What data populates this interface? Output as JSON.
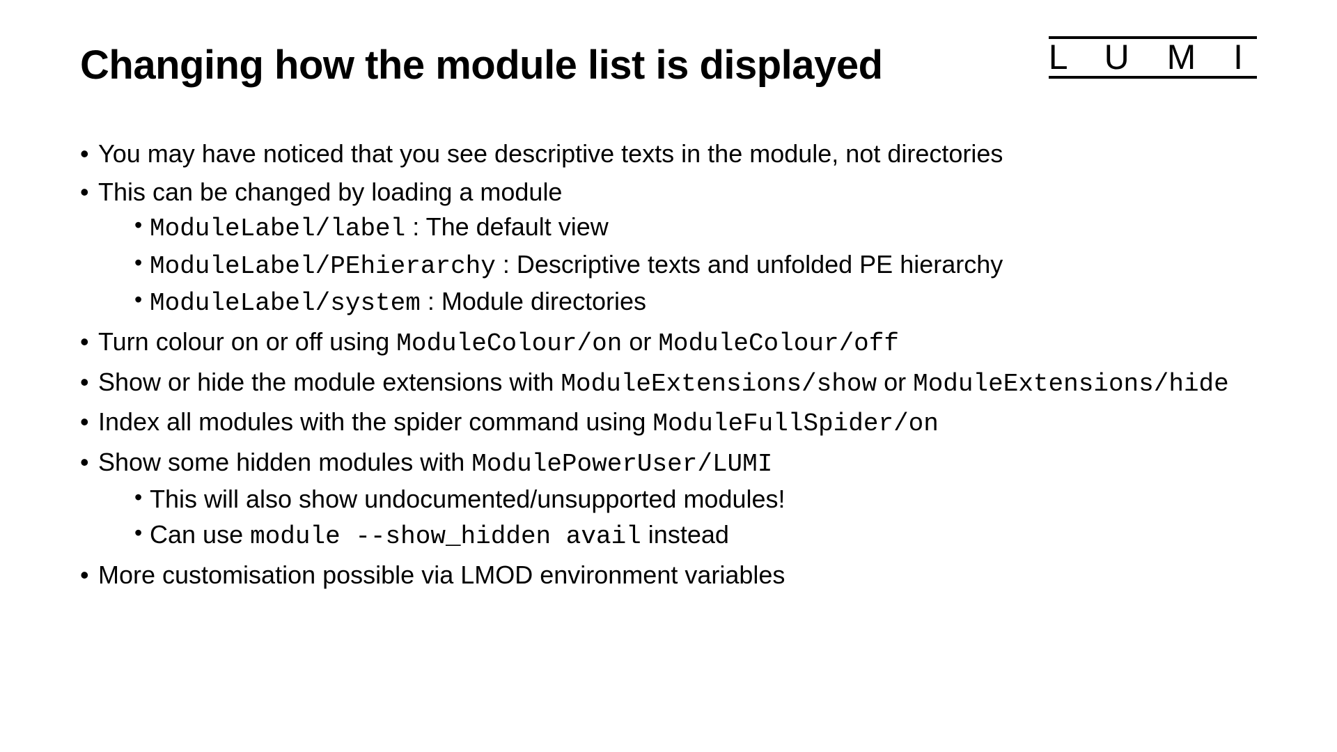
{
  "title": "Changing how the module list is displayed",
  "logo": "L U M I",
  "bullets": {
    "b1": "You may have noticed that you see descriptive texts in the module, not directories",
    "b2": "This can be changed by loading a module",
    "b2a_code": "ModuleLabel/label",
    "b2a_rest": " : The default view",
    "b2b_code": "ModuleLabel/PEhierarchy",
    "b2b_rest": " : Descriptive texts and unfolded PE hierarchy",
    "b2c_code": "ModuleLabel/system",
    "b2c_rest": " : Module directories",
    "b3_pre": "Turn colour on or off using ",
    "b3_code1": "ModuleColour/on",
    "b3_mid": " or ",
    "b3_code2": "ModuleColour/off",
    "b4_pre": "Show or hide the module extensions with ",
    "b4_code1": "ModuleExtensions/show",
    "b4_mid": " or ",
    "b4_code2": "ModuleExtensions/hide",
    "b5_pre": "Index all modules with the spider command using ",
    "b5_code": "ModuleFullSpider/on",
    "b6_pre": "Show some hidden modules with ",
    "b6_code": "ModulePowerUser/LUMI",
    "b6a": "This will also show undocumented/unsupported modules!",
    "b6b_pre": "Can use ",
    "b6b_code": "module --show_hidden avail",
    "b6b_post": " instead",
    "b7": "More customisation possible via LMOD environment variables"
  }
}
